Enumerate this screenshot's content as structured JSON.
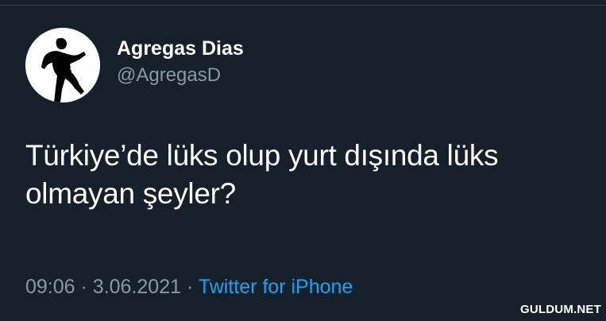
{
  "tweet": {
    "author": {
      "display_name": "Agregas Dias",
      "handle": "@AgregasD",
      "avatar_icon": "silhouette-avatar-icon"
    },
    "text_lines": [
      "Türkiye’de lüks olup yurt dışında lüks",
      "olmayan şeyler?"
    ],
    "time": "09:06",
    "date": "3.06.2021",
    "separator": "·",
    "source": "Twitter for iPhone"
  },
  "watermark": "GULDUM.NET",
  "colors": {
    "background": "#15202b",
    "text": "#ffffff",
    "secondary_text": "#8899a6",
    "link": "#1da1f2",
    "divider": "#38444d"
  }
}
